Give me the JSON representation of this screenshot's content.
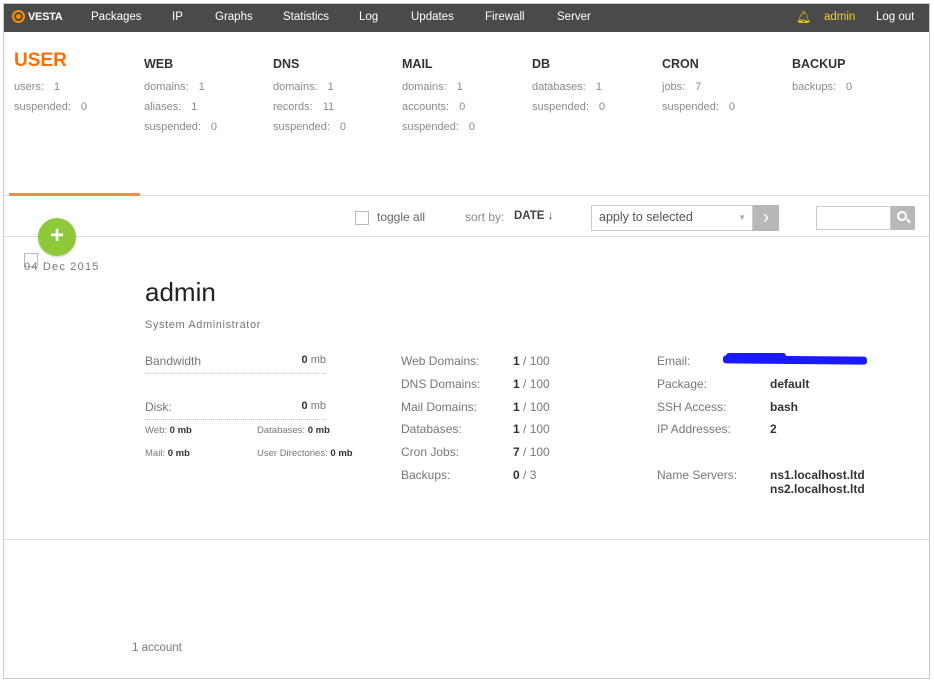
{
  "topbar": {
    "logo": "VESTA",
    "nav": [
      "Packages",
      "IP",
      "Graphs",
      "Statistics",
      "Log",
      "Updates",
      "Firewall",
      "Server"
    ],
    "username": "admin",
    "logout": "Log out"
  },
  "stats": {
    "user": {
      "title": "USER",
      "rows": [
        [
          "users:",
          "1"
        ],
        [
          "suspended:",
          "0"
        ]
      ]
    },
    "web": {
      "title": "WEB",
      "rows": [
        [
          "domains:",
          "1"
        ],
        [
          "aliases:",
          "1"
        ],
        [
          "suspended:",
          "0"
        ]
      ]
    },
    "dns": {
      "title": "DNS",
      "rows": [
        [
          "domains:",
          "1"
        ],
        [
          "records:",
          "11"
        ],
        [
          "suspended:",
          "0"
        ]
      ]
    },
    "mail": {
      "title": "MAIL",
      "rows": [
        [
          "domains:",
          "1"
        ],
        [
          "accounts:",
          "0"
        ],
        [
          "suspended:",
          "0"
        ]
      ]
    },
    "db": {
      "title": "DB",
      "rows": [
        [
          "databases:",
          "1"
        ],
        [
          "suspended:",
          "0"
        ]
      ]
    },
    "cron": {
      "title": "CRON",
      "rows": [
        [
          "jobs:",
          "7"
        ],
        [
          "suspended:",
          "0"
        ]
      ]
    },
    "backup": {
      "title": "BACKUP",
      "rows": [
        [
          "backups:",
          "0"
        ]
      ]
    }
  },
  "toolbar": {
    "toggle_all": "toggle all",
    "sort_by": "sort by:",
    "sort_value": "DATE ↓",
    "apply_select": "apply to selected"
  },
  "add_button": "+",
  "user": {
    "date": "04 Dec 2015",
    "name": "admin",
    "full_name": "System Administrator",
    "bandwidth_label": "Bandwidth",
    "bandwidth_value": "0",
    "bandwidth_unit": "mb",
    "disk_label": "Disk:",
    "disk_value": "0",
    "disk_unit": "mb",
    "web_label": "Web:",
    "web_value": "0 mb",
    "databases_label": "Databases:",
    "databases_value": "0 mb",
    "mail_label": "Mail:",
    "mail_value": "0 mb",
    "userdirs_label": "User Directories:",
    "userdirs_value": "0 mb",
    "counts": [
      {
        "label": "Web Domains:",
        "used": "1",
        "limit": "/ 100"
      },
      {
        "label": "DNS Domains:",
        "used": "1",
        "limit": "/ 100"
      },
      {
        "label": "Mail Domains:",
        "used": "1",
        "limit": "/ 100"
      },
      {
        "label": "Databases:",
        "used": "1",
        "limit": "/ 100"
      },
      {
        "label": "Cron Jobs:",
        "used": "7",
        "limit": "/ 100"
      },
      {
        "label": "Backups:",
        "used": "0",
        "limit": "/ 3"
      }
    ],
    "details": {
      "email_label": "Email:",
      "package_label": "Package:",
      "package_value": "default",
      "ssh_label": "SSH Access:",
      "ssh_value": "bash",
      "ip_label": "IP Addresses:",
      "ip_value": "2",
      "ns_label": "Name Servers:",
      "ns1": "ns1.localhost.ltd",
      "ns2": "ns2.localhost.ltd"
    }
  },
  "footer": "1 account",
  "colors": {
    "topbar": "#4a4a4a",
    "accent": "#ff6e00",
    "add": "#8fc93a",
    "username": "#ffcc00"
  }
}
